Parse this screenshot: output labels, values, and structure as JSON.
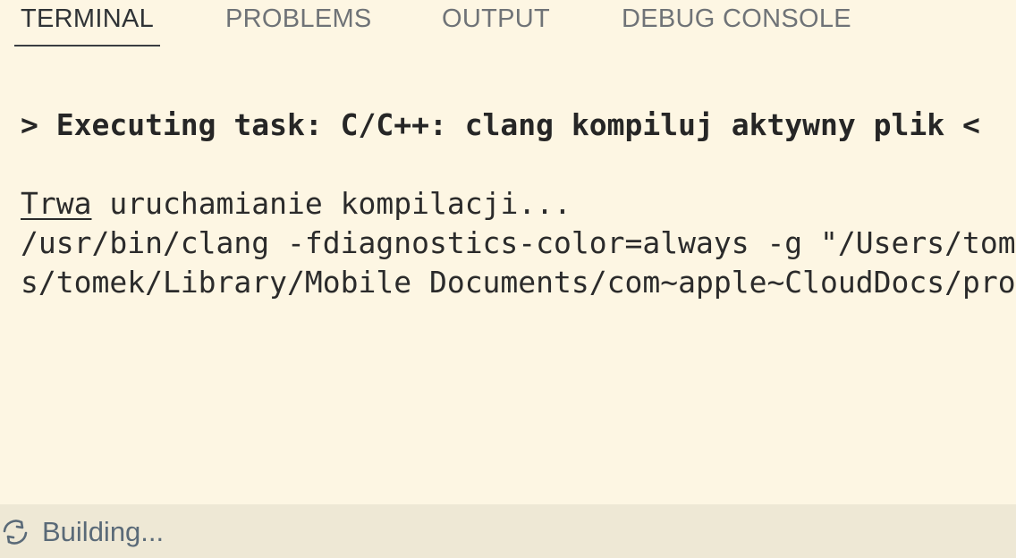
{
  "tabs": [
    {
      "label": "TERMINAL",
      "active": true
    },
    {
      "label": "PROBLEMS",
      "active": false
    },
    {
      "label": "OUTPUT",
      "active": false
    },
    {
      "label": "DEBUG CONSOLE",
      "active": false
    }
  ],
  "terminal": {
    "task_line": "> Executing task: C/C++: clang kompiluj aktywny plik <",
    "status_link": "Trwa",
    "status_rest": " uruchamianie kompilacji...",
    "command_line_1": "/usr/bin/clang -fdiagnostics-color=always -g \"/Users/tomek/Library/Mobile Documents/com~apple~CloudDocs/pro",
    "command_line_2": "s/tomek/Library/Mobile Documents/com~apple~CloudDocs/pro"
  },
  "statusbar": {
    "icon": "sync-icon",
    "text": "Building..."
  },
  "colors": {
    "background": "#fdf6e3",
    "statusbar_background": "#eee8d5",
    "status_text": "#5a6a78"
  }
}
